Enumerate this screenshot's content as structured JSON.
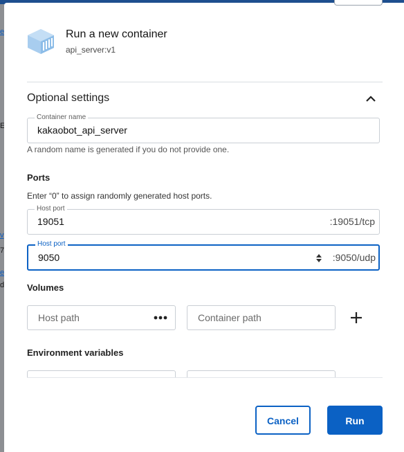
{
  "dialog": {
    "title": "Run a new container",
    "image": "api_server:v1",
    "logo_icon": "container-cube-icon"
  },
  "optional_settings": {
    "title": "Optional settings",
    "collapse_icon": "chevron-up-icon",
    "container_name": {
      "label": "Container name",
      "value": "kakaobot_api_server",
      "helper": "A random name is generated if you do not provide one."
    }
  },
  "ports": {
    "title": "Ports",
    "hint": "Enter “0” to assign randomly generated host ports.",
    "items": [
      {
        "label": "Host port",
        "value": "19051",
        "suffix": ":19051/tcp"
      },
      {
        "label": "Host port",
        "value": "9050",
        "suffix": ":9050/udp"
      }
    ]
  },
  "volumes": {
    "title": "Volumes",
    "host_path_placeholder": "Host path",
    "container_path_placeholder": "Container path",
    "browse_icon": "more-dots-icon",
    "add_icon": "plus-icon"
  },
  "environment": {
    "title": "Environment variables"
  },
  "footer": {
    "cancel_label": "Cancel",
    "run_label": "Run"
  },
  "background": {
    "fragments": [
      "e",
      "E",
      "v",
      "7(",
      "e",
      "d"
    ]
  },
  "colors": {
    "accent": "#0b61c4",
    "logo": "#a8cdef"
  }
}
